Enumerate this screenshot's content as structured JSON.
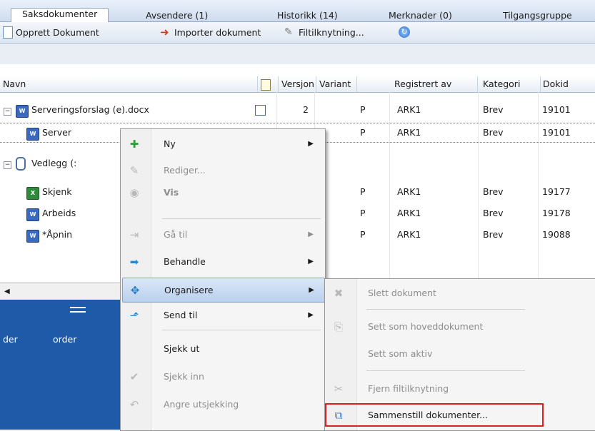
{
  "tabs": [
    {
      "label": "Saksdokumenter",
      "active": true
    },
    {
      "label": "Avsendere (1)"
    },
    {
      "label": "Historikk (14)"
    },
    {
      "label": "Merknader (0)"
    },
    {
      "label": "Tilgangsgruppe"
    }
  ],
  "toolbar": {
    "create": "Opprett Dokument",
    "import": "Importer dokument",
    "filelink": "Filtilknytning..."
  },
  "columns": [
    "Navn",
    "Versjon",
    "Variant",
    "Registrert av",
    "Kategori",
    "Dokid"
  ],
  "rows": [
    {
      "name": "Serveringsforslag (e).docx",
      "version": "2",
      "variant": "P",
      "registered": "ARK1",
      "category": "Brev",
      "dokid": "19101"
    },
    {
      "name": "Server",
      "variant": "P",
      "registered": "ARK1",
      "category": "Brev",
      "dokid": "19101"
    },
    {
      "name": "Vedlegg (:"
    },
    {
      "name": "Skjenk",
      "variant": "P",
      "registered": "ARK1",
      "category": "Brev",
      "dokid": "19177"
    },
    {
      "name": "Arbeids",
      "variant": "P",
      "registered": "ARK1",
      "category": "Brev",
      "dokid": "19178"
    },
    {
      "name": "*Åpnin",
      "variant": "P",
      "registered": "ARK1",
      "category": "Brev",
      "dokid": "19088"
    }
  ],
  "bottom": {
    "label1": "der",
    "label2": "order"
  },
  "context_menu": {
    "items": [
      {
        "label": "Ny",
        "icon": "plus-icon",
        "submenu": true
      },
      {
        "label": "Rediger...",
        "icon": "pencil-icon",
        "disabled": true
      },
      {
        "label": "Vis",
        "icon": "eye-icon",
        "disabled": true
      },
      {
        "label": "Gå til",
        "icon": "goto-icon",
        "disabled": true,
        "submenu": true
      },
      {
        "label": "Behandle",
        "icon": "arrow-icon",
        "submenu": true
      },
      {
        "label": "Organisere",
        "icon": "move-icon",
        "submenu": true,
        "highlighted": true
      },
      {
        "label": "Send til",
        "icon": "send-icon",
        "submenu": true
      },
      {
        "label": "Sjekk ut"
      },
      {
        "label": "Sjekk inn",
        "icon": "check-icon",
        "disabled": true
      },
      {
        "label": "Angre utsjekking",
        "icon": "undo-icon",
        "disabled": true
      }
    ]
  },
  "submenu": {
    "items": [
      {
        "label": "Slett dokument",
        "icon": "delete-icon",
        "disabled": true
      },
      {
        "label": "Sett som hoveddokument",
        "icon": "main-doc-icon",
        "disabled": true
      },
      {
        "label": "Sett som aktiv",
        "disabled": true
      },
      {
        "label": "Fjern filtilknytning",
        "icon": "unlink-icon",
        "disabled": true
      },
      {
        "label": "Sammenstill dokumenter...",
        "icon": "merge-icon",
        "highlighted": true
      }
    ]
  },
  "colors": {
    "highlight_box": "#e02020",
    "bottom_panel": "#1e5aa8"
  }
}
